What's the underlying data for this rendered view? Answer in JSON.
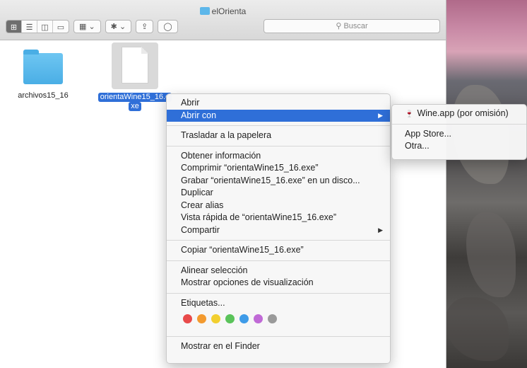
{
  "window": {
    "title": "elOrienta",
    "search_placeholder": "Buscar"
  },
  "toolbar": {
    "view_icons": [
      "icon-view-icon",
      "list-view-icon",
      "column-view-icon",
      "coverflow-view-icon"
    ],
    "arrange_label": "▦ ⌄",
    "action_label": "✱ ⌄",
    "share_label": "⇪",
    "tag_label": "◯"
  },
  "files": [
    {
      "name": "archivos15_16",
      "type": "folder",
      "selected": false
    },
    {
      "name_line1": "orientaWine15_16.e",
      "name_line2": "xe",
      "type": "file",
      "selected": true
    }
  ],
  "context_menu": {
    "items": [
      {
        "label": "Abrir"
      },
      {
        "label": "Abrir con",
        "active": true,
        "submenu": true
      },
      {
        "label": "Trasladar a la papelera"
      },
      {
        "label": "Obtener información"
      },
      {
        "label": "Comprimir “orientaWine15_16.exe”"
      },
      {
        "label": "Grabar “orientaWine15_16.exe” en un disco..."
      },
      {
        "label": "Duplicar"
      },
      {
        "label": "Crear alias"
      },
      {
        "label": "Vista rápida de “orientaWine15_16.exe”"
      },
      {
        "label": "Compartir",
        "submenu": true
      },
      {
        "label": "Copiar “orientaWine15_16.exe”"
      },
      {
        "label": "Alinear selección"
      },
      {
        "label": "Mostrar opciones de visualización"
      },
      {
        "label": "Etiquetas..."
      },
      {
        "label": "Mostrar en el Finder"
      }
    ],
    "tag_colors": [
      "#e84a4a",
      "#f39a2f",
      "#f2cf2f",
      "#5ac35a",
      "#3e9be8",
      "#c06ad6",
      "#9a9a9a"
    ]
  },
  "submenu": {
    "items": [
      {
        "label": "Wine.app (por omisión)",
        "icon": "wine-icon"
      },
      {
        "label": "App Store..."
      },
      {
        "label": "Otra..."
      }
    ]
  }
}
